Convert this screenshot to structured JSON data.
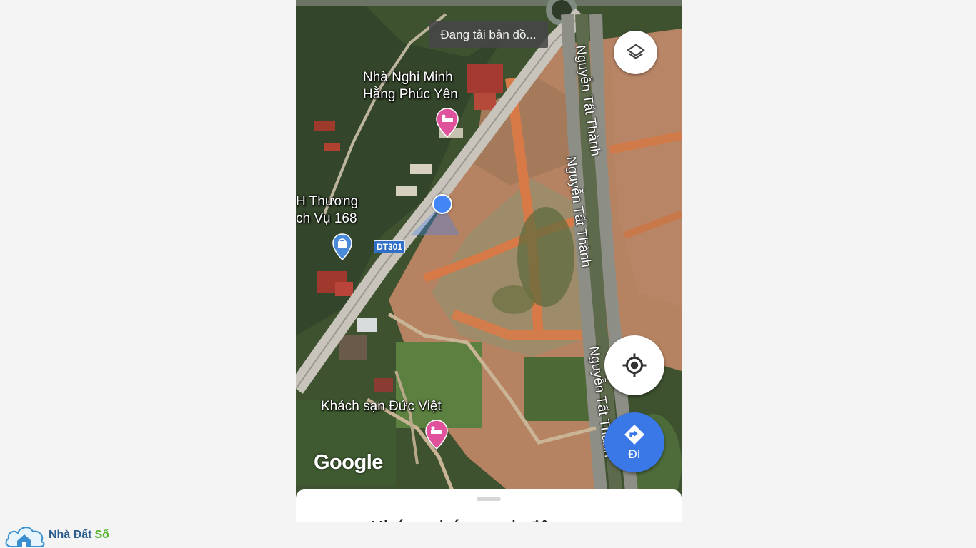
{
  "map": {
    "loading_text": "Đang tải bản đồ...",
    "places": [
      {
        "name": "Nhà Nghỉ Minh",
        "name2": "Hằng Phúc Yên",
        "icon": "hotel-pin-icon"
      },
      {
        "name": "H Thương",
        "name2": "ch Vụ 168",
        "icon": "shopping-pin-icon"
      },
      {
        "name": "Khách sạn Đức Việt",
        "icon": "hotel-pin-icon"
      }
    ],
    "roads": [
      "Nguyễn Tất Thành",
      "Nguyễn Tất Thành",
      "Nguyễn Tất Thành"
    ],
    "road_shield": "DT301",
    "attribution": "Google",
    "colors": {
      "hotel_pin": "#e0529c",
      "shop_pin": "#4a8ad8",
      "my_location": "#4285f4",
      "go_button": "#3b78e7"
    }
  },
  "controls": {
    "layers_icon": "layers-icon",
    "location_icon": "my-location-icon",
    "go_label": "ĐI",
    "go_icon": "directions-icon"
  },
  "sheet": {
    "title": "Khám phá quanh đây"
  },
  "watermark": {
    "text_a": "Nhà Đất",
    "text_b": "Số"
  }
}
